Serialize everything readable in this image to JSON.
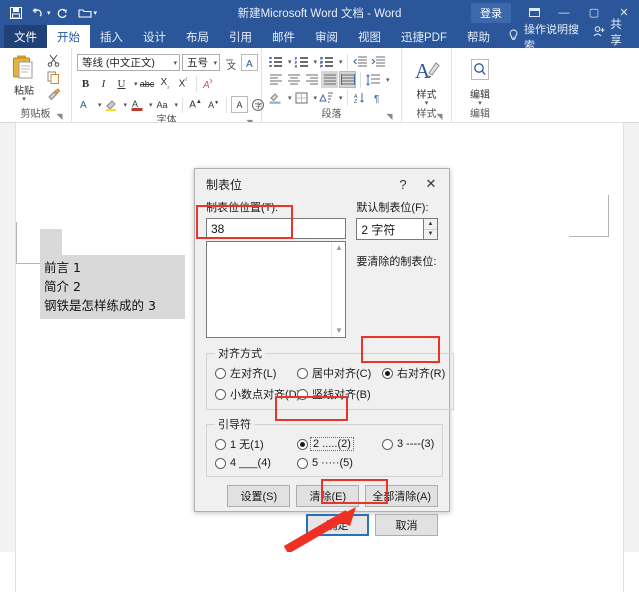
{
  "titlebar": {
    "document_title": "新建Microsoft Word 文档  -  Word",
    "signin_label": "登录",
    "quick_access": [
      {
        "name": "save",
        "glyph": "☗"
      },
      {
        "name": "undo",
        "glyph": "↶"
      },
      {
        "name": "redo",
        "glyph": "↻"
      },
      {
        "name": "open",
        "glyph": "🗀"
      },
      {
        "name": "customize",
        "glyph": "≡"
      }
    ],
    "window_buttons": [
      {
        "name": "ribbon-display-options",
        "glyph": "⬚"
      },
      {
        "name": "minimize",
        "glyph": "—"
      },
      {
        "name": "maximize",
        "glyph": "☐"
      },
      {
        "name": "close",
        "glyph": "✕"
      }
    ]
  },
  "tabs": [
    {
      "label": "文件",
      "kind": "file"
    },
    {
      "label": "开始",
      "kind": "active"
    },
    {
      "label": "插入",
      "kind": "normal"
    },
    {
      "label": "设计",
      "kind": "normal"
    },
    {
      "label": "布局",
      "kind": "normal"
    },
    {
      "label": "引用",
      "kind": "normal"
    },
    {
      "label": "邮件",
      "kind": "normal"
    },
    {
      "label": "审阅",
      "kind": "normal"
    },
    {
      "label": "视图",
      "kind": "normal"
    },
    {
      "label": "迅捷PDF",
      "kind": "normal"
    },
    {
      "label": "帮助",
      "kind": "normal"
    }
  ],
  "tellme": {
    "label": "操作说明搜索",
    "icon": "lightbulb-icon"
  },
  "share": {
    "label": "共享"
  },
  "ribbon": {
    "clipboard": {
      "group_label": "剪贴板",
      "paste_label": "粘贴",
      "buttons": [
        "剪切",
        "复制",
        "格式刷"
      ]
    },
    "font": {
      "group_label": "字体",
      "font_name": "等线 (中文正文)",
      "font_size": "五号"
    },
    "paragraph": {
      "group_label": "段落"
    },
    "styles": {
      "group_label": "样式",
      "button_label": "样式"
    },
    "editing": {
      "group_label": "编辑",
      "button_label": "编辑"
    }
  },
  "document": {
    "lines": [
      "前言 1",
      "简介 2",
      "钢铁是怎样练成的 3"
    ]
  },
  "dialog": {
    "title": "制表位",
    "help_glyph": "?",
    "close_glyph": "✕",
    "tab_position": {
      "label": "制表位位置(T):",
      "value": "38"
    },
    "default_tab": {
      "label": "默认制表位(F):",
      "value": "2 字符"
    },
    "to_clear": {
      "label": "要清除的制表位:"
    },
    "alignment": {
      "legend": "对齐方式",
      "options": [
        {
          "label": "左对齐(L)",
          "selected": false
        },
        {
          "label": "居中对齐(C)",
          "selected": false
        },
        {
          "label": "右对齐(R)",
          "selected": true
        },
        {
          "label": "小数点对齐(D)",
          "selected": false
        },
        {
          "label": "竖线对齐(B)",
          "selected": false
        }
      ]
    },
    "leader": {
      "legend": "引导符",
      "options": [
        {
          "label": "1 无(1)",
          "selected": false
        },
        {
          "label": "2 .....(2)",
          "selected": true
        },
        {
          "label": "3 ----(3)",
          "selected": false
        },
        {
          "label": "4 ___(4)",
          "selected": false
        },
        {
          "label": "5 ·····(5)",
          "selected": false
        }
      ]
    },
    "buttons": {
      "set": "设置(S)",
      "clear": "清除(E)",
      "clear_all": "全部清除(A)",
      "ok": "确定",
      "cancel": "取消"
    }
  },
  "annotations": {
    "accent_color": "#e8352b",
    "highlight_targets": [
      "制表位位置(T): 输入框",
      "右对齐(R)",
      "2 .....(2)",
      "确定"
    ]
  }
}
